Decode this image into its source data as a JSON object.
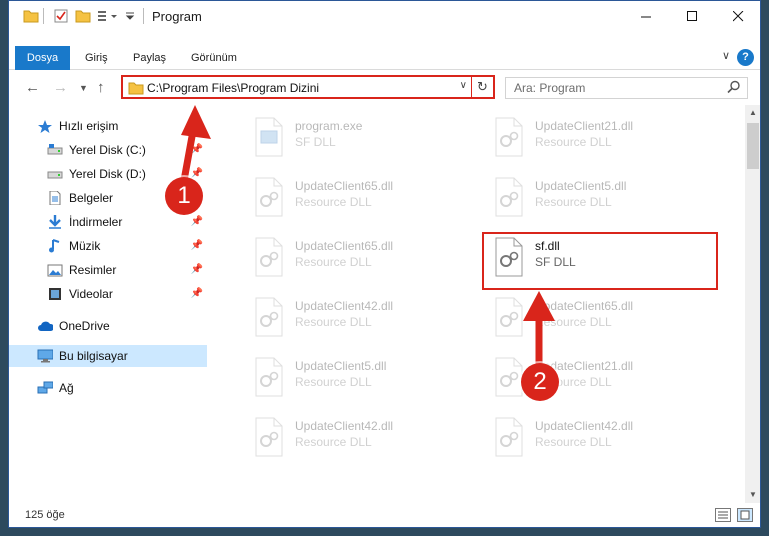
{
  "window": {
    "title": "Program"
  },
  "ribbon": {
    "tabs": [
      "Dosya",
      "Giriş",
      "Paylaş",
      "Görünüm"
    ],
    "help": "?"
  },
  "address": {
    "path": "C:\\Program Files\\Program Dizini"
  },
  "search": {
    "placeholder": "Ara: Program"
  },
  "sidebar": {
    "items": [
      {
        "label": "Hızlı erişim",
        "icon": "star-icon"
      },
      {
        "label": "Yerel Disk (C:)",
        "icon": "drive-icon"
      },
      {
        "label": "Yerel Disk (D:)",
        "icon": "drive-icon"
      },
      {
        "label": "Belgeler",
        "icon": "document-icon"
      },
      {
        "label": "İndirmeler",
        "icon": "download-icon"
      },
      {
        "label": "Müzik",
        "icon": "music-icon"
      },
      {
        "label": "Resimler",
        "icon": "pictures-icon"
      },
      {
        "label": "Videolar",
        "icon": "video-icon"
      },
      {
        "label": "OneDrive",
        "icon": "cloud-icon"
      },
      {
        "label": "Bu bilgisayar",
        "icon": "computer-icon"
      },
      {
        "label": "Ağ",
        "icon": "network-icon"
      }
    ]
  },
  "files": [
    {
      "name": "program.exe",
      "desc": "SF DLL"
    },
    {
      "name": "UpdateClient21.dll",
      "desc": "Resource DLL"
    },
    {
      "name": "UpdateClient65.dll",
      "desc": "Resource DLL"
    },
    {
      "name": "UpdateClient5.dll",
      "desc": "Resource DLL"
    },
    {
      "name": "UpdateClient65.dll",
      "desc": "Resource DLL"
    },
    {
      "name": "sf.dll",
      "desc": "SF DLL"
    },
    {
      "name": "UpdateClient42.dll",
      "desc": "Resource DLL"
    },
    {
      "name": "UpdateClient65.dll",
      "desc": "Resource DLL"
    },
    {
      "name": "UpdateClient5.dll",
      "desc": "Resource DLL"
    },
    {
      "name": "UpdateClient21.dll",
      "desc": "Resource DLL"
    },
    {
      "name": "UpdateClient42.dll",
      "desc": "Resource DLL"
    },
    {
      "name": "UpdateClient42.dll",
      "desc": "Resource DLL"
    }
  ],
  "status": {
    "count": "125 öğe"
  },
  "annotations": {
    "badge1": "1",
    "badge2": "2"
  },
  "colors": {
    "accent": "#1979ca",
    "highlight": "#d9251b",
    "selected": "#cce8ff"
  }
}
